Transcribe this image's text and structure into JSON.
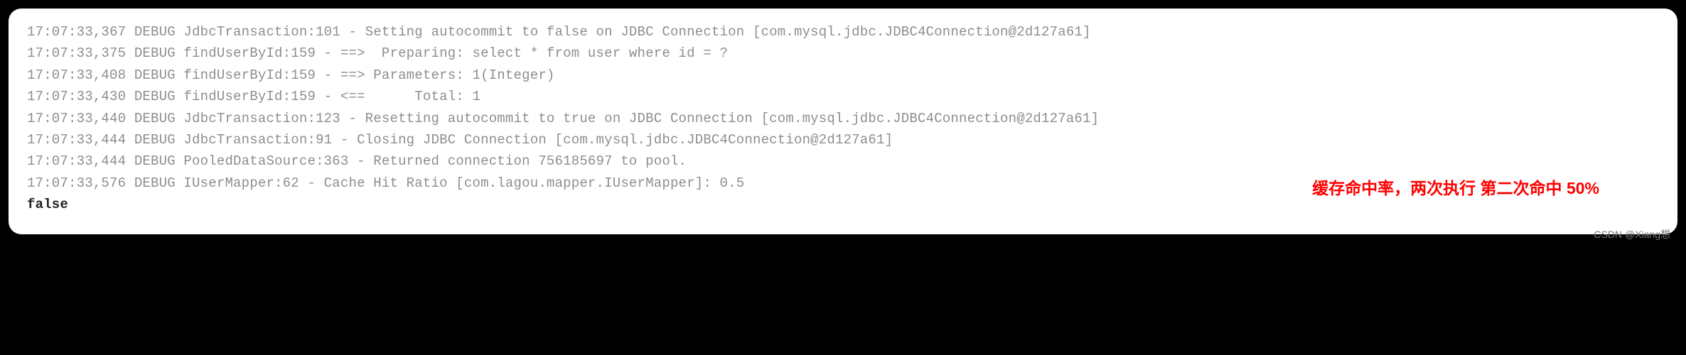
{
  "logs": [
    {
      "ts": "17:07:33,367",
      "level": "DEBUG",
      "logger": "JdbcTransaction",
      "line": "101",
      "msg": "Setting autocommit to false on JDBC Connection [com.mysql.jdbc.JDBC4Connection@2d127a61]"
    },
    {
      "ts": "17:07:33,375",
      "level": "DEBUG",
      "logger": "findUserById",
      "line": "159",
      "msg": "==>  Preparing: select * from user where id = ?"
    },
    {
      "ts": "17:07:33,408",
      "level": "DEBUG",
      "logger": "findUserById",
      "line": "159",
      "msg": "==> Parameters: 1(Integer)"
    },
    {
      "ts": "17:07:33,430",
      "level": "DEBUG",
      "logger": "findUserById",
      "line": "159",
      "msg": "<==      Total: 1"
    },
    {
      "ts": "17:07:33,440",
      "level": "DEBUG",
      "logger": "JdbcTransaction",
      "line": "123",
      "msg": "Resetting autocommit to true on JDBC Connection [com.mysql.jdbc.JDBC4Connection@2d127a61]"
    },
    {
      "ts": "17:07:33,444",
      "level": "DEBUG",
      "logger": "JdbcTransaction",
      "line": "91",
      "msg": "Closing JDBC Connection [com.mysql.jdbc.JDBC4Connection@2d127a61]"
    },
    {
      "ts": "17:07:33,444",
      "level": "DEBUG",
      "logger": "PooledDataSource",
      "line": "363",
      "msg": "Returned connection 756185697 to pool."
    },
    {
      "ts": "17:07:33,576",
      "level": "DEBUG",
      "logger": "IUserMapper",
      "line": "62",
      "msg": "Cache Hit Ratio [com.lagou.mapper.IUserMapper]: 0.5"
    }
  ],
  "result": "false",
  "annotation": "缓存命中率，两次执行 第二次命中 50%",
  "watermark": "CSDN @Xiang想"
}
